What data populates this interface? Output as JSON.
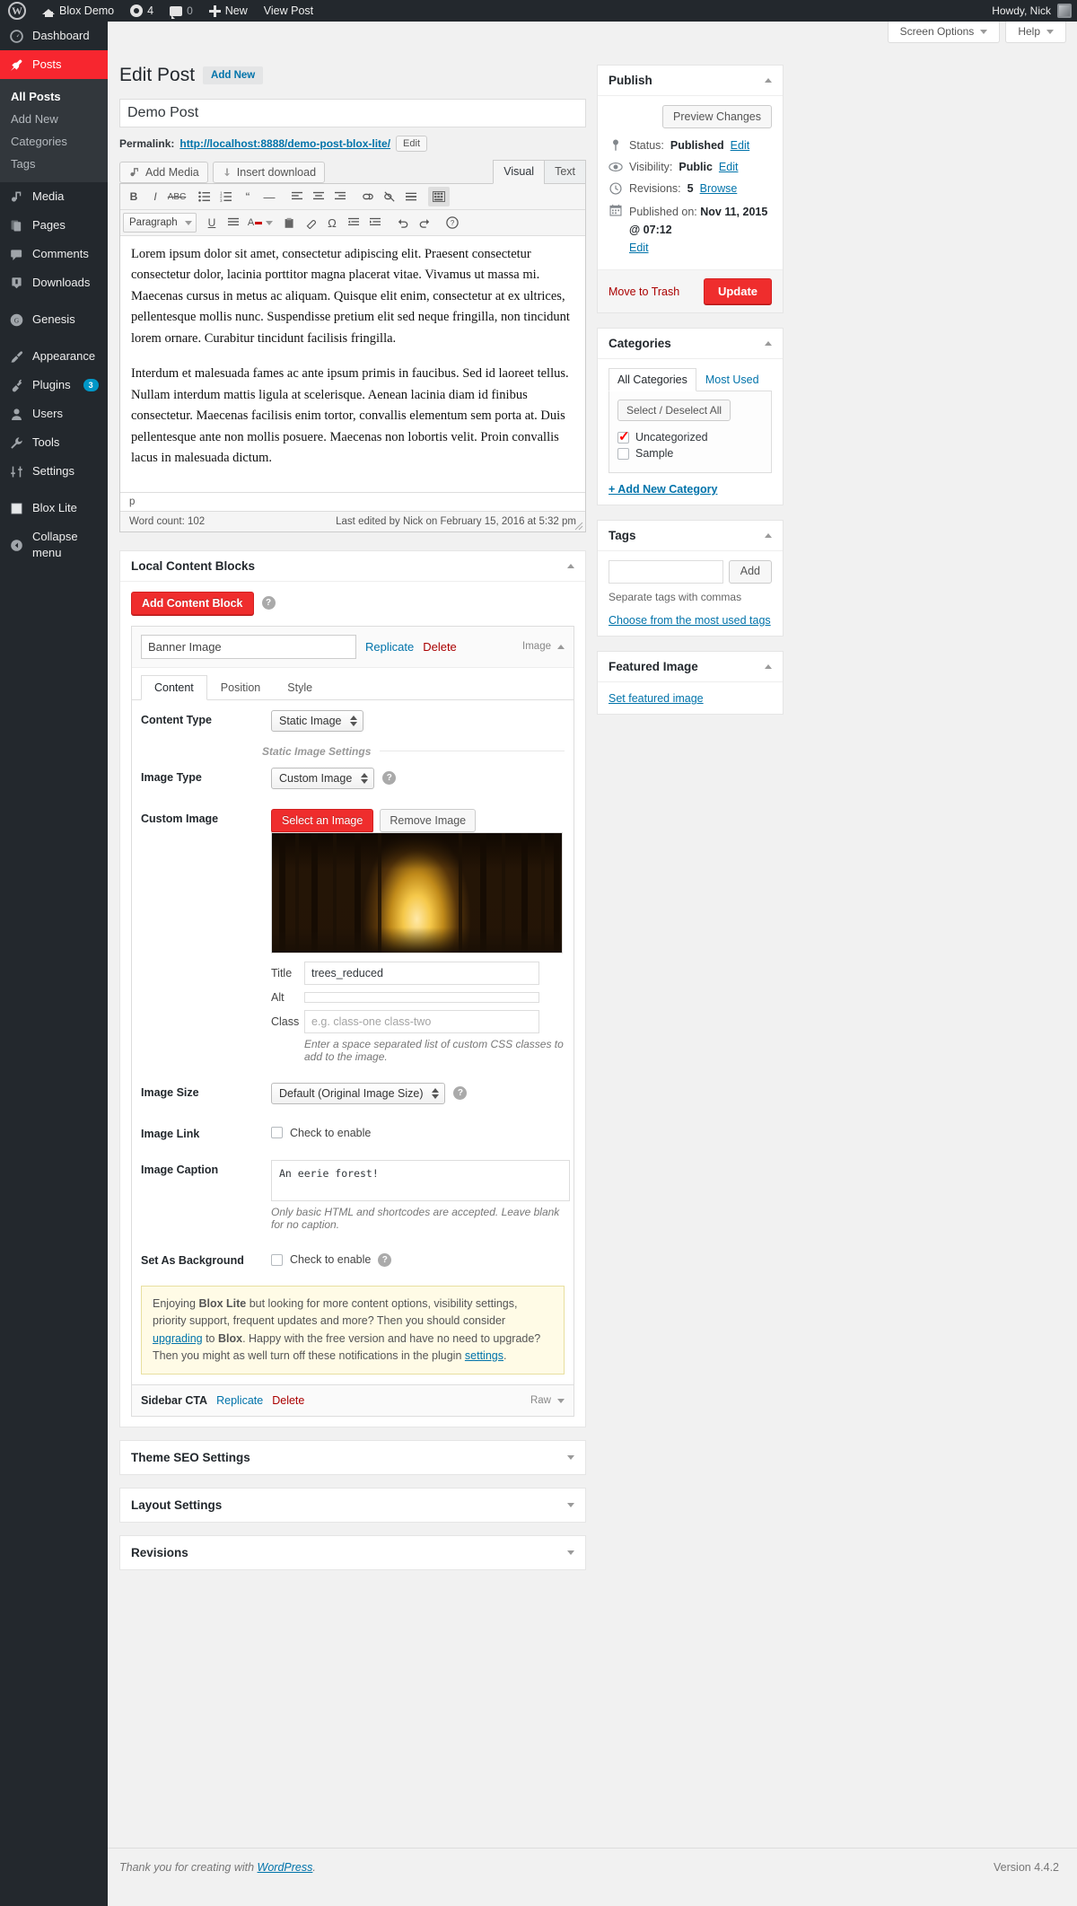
{
  "adminbar": {
    "site_name": "Blox Demo",
    "revision_count": "4",
    "comment_count": "0",
    "new_label": "New",
    "view_post_label": "View Post",
    "howdy": "Howdy, Nick"
  },
  "sidebar": {
    "items": [
      {
        "label": "Dashboard",
        "icon": "dashboard-icon"
      },
      {
        "label": "Posts",
        "icon": "pin-icon",
        "current": true
      },
      {
        "label": "Media",
        "icon": "media-icon"
      },
      {
        "label": "Pages",
        "icon": "pages-icon"
      },
      {
        "label": "Comments",
        "icon": "comment-icon"
      },
      {
        "label": "Downloads",
        "icon": "download-icon"
      },
      {
        "label": "Genesis",
        "icon": "genesis-icon"
      },
      {
        "label": "Appearance",
        "icon": "brush-icon"
      },
      {
        "label": "Plugins",
        "icon": "plug-icon",
        "badge": "3"
      },
      {
        "label": "Users",
        "icon": "user-icon"
      },
      {
        "label": "Tools",
        "icon": "wrench-icon"
      },
      {
        "label": "Settings",
        "icon": "sliders-icon"
      },
      {
        "label": "Blox Lite",
        "icon": "square-icon"
      },
      {
        "label": "Collapse menu",
        "icon": "collapse-icon"
      }
    ],
    "posts_submenu": [
      {
        "label": "All Posts",
        "current": true
      },
      {
        "label": "Add New"
      },
      {
        "label": "Categories"
      },
      {
        "label": "Tags"
      }
    ]
  },
  "screen_meta": {
    "screen_options": "Screen Options",
    "help": "Help"
  },
  "header": {
    "title": "Edit Post",
    "add_new": "Add New"
  },
  "post": {
    "title": "Demo Post",
    "permalink_label": "Permalink:",
    "permalink_url": "http://localhost:8888/demo-post-blox-lite/",
    "permalink_edit": "Edit"
  },
  "editor": {
    "add_media": "Add Media",
    "insert_download": "Insert download",
    "tab_visual": "Visual",
    "tab_text": "Text",
    "format_select": "Paragraph",
    "paragraph_1": "Lorem ipsum dolor sit amet, consectetur adipiscing elit. Praesent consectetur consectetur dolor, lacinia porttitor magna placerat vitae. Vivamus ut massa mi. Maecenas cursus in metus ac aliquam. Quisque elit enim, consectetur at ex ultrices, pellentesque mollis nunc. Suspendisse pretium elit sed neque fringilla, non tincidunt lorem ornare. Curabitur tincidunt facilisis fringilla.",
    "paragraph_2": "Interdum et malesuada fames ac ante ipsum primis in faucibus. Sed id laoreet tellus. Nullam interdum mattis ligula at scelerisque. Aenean lacinia diam id finibus consectetur. Maecenas facilisis enim tortor, convallis elementum sem porta at. Duis pellentesque ante non mollis posuere. Maecenas non lobortis velit. Proin convallis lacus in malesuada dictum.",
    "path": "p",
    "word_count": "Word count: 102",
    "last_edited": "Last edited by Nick on February 15, 2016 at 5:32 pm"
  },
  "blox": {
    "panel_title": "Local Content Blocks",
    "add_block_button": "Add Content Block",
    "block": {
      "name": "Banner Image",
      "replicate": "Replicate",
      "delete": "Delete",
      "type_label": "Image",
      "tabs": [
        {
          "label": "Content",
          "active": true
        },
        {
          "label": "Position",
          "active": false
        },
        {
          "label": "Style",
          "active": false
        }
      ],
      "content_type_label": "Content Type",
      "content_type_value": "Static Image",
      "static_image_settings": "Static Image Settings",
      "image_type_label": "Image Type",
      "image_type_value": "Custom Image",
      "custom_image_label": "Custom Image",
      "select_image_button": "Select an Image",
      "remove_image_button": "Remove Image",
      "title_label": "Title",
      "title_value": "trees_reduced",
      "alt_label": "Alt",
      "alt_value": "",
      "class_label": "Class",
      "class_placeholder": "e.g. class-one class-two",
      "class_hint": "Enter a space separated list of custom CSS classes to add to the image.",
      "image_size_label": "Image Size",
      "image_size_value": "Default (Original Image Size)",
      "image_link_label": "Image Link",
      "image_link_checkbox": "Check to enable",
      "image_caption_label": "Image Caption",
      "image_caption_value": "An eerie forest!",
      "caption_hint": "Only basic HTML and shortcodes are accepted. Leave blank for no caption.",
      "set_background_label": "Set As Background",
      "set_background_checkbox": "Check to enable"
    },
    "notice": {
      "part1": "Enjoying ",
      "strong1": "Blox Lite",
      "part2": " but looking for more content options, visibility settings, priority support, frequent updates and more? Then you should consider ",
      "link1": "upgrading",
      "part3": " to ",
      "strong2": "Blox",
      "part4": ". Happy with the free version and have no need to upgrade? Then you might as well turn off these notifications in the plugin ",
      "link2": "settings",
      "part5": "."
    },
    "second_block": {
      "name": "Sidebar CTA",
      "replicate": "Replicate",
      "delete": "Delete",
      "type_label": "Raw"
    }
  },
  "collapsed_panels": [
    {
      "label": "Theme SEO Settings"
    },
    {
      "label": "Layout Settings"
    },
    {
      "label": "Revisions"
    }
  ],
  "publish": {
    "title": "Publish",
    "preview_changes": "Preview Changes",
    "status_label": "Status:",
    "status_value": "Published",
    "status_edit": "Edit",
    "visibility_label": "Visibility:",
    "visibility_value": "Public",
    "visibility_edit": "Edit",
    "revisions_label": "Revisions:",
    "revisions_value": "5",
    "revisions_browse": "Browse",
    "published_on_label": "Published on:",
    "published_on_value": "Nov 11, 2015 @ 07:12",
    "published_edit": "Edit",
    "move_to_trash": "Move to Trash",
    "update_button": "Update"
  },
  "categories": {
    "title": "Categories",
    "tab_all": "All Categories",
    "tab_most_used": "Most Used",
    "select_deselect": "Select / Deselect All",
    "items": [
      {
        "label": "Uncategorized",
        "checked": true
      },
      {
        "label": "Sample",
        "checked": false
      }
    ],
    "add_new": "+ Add New Category"
  },
  "tags": {
    "title": "Tags",
    "add_button": "Add",
    "separate_hint": "Separate tags with commas",
    "choose_link": "Choose from the most used tags"
  },
  "featured_image": {
    "title": "Featured Image",
    "set_link": "Set featured image"
  },
  "footer": {
    "thanks_prefix": "Thank you for creating with ",
    "wordpress": "WordPress",
    "thanks_suffix": ".",
    "version": "Version 4.4.2"
  },
  "colors": {
    "accent_red": "#ef2d2d",
    "link_blue": "#0073aa",
    "admin_dark": "#23282d",
    "badge_blue": "#0097c7"
  }
}
